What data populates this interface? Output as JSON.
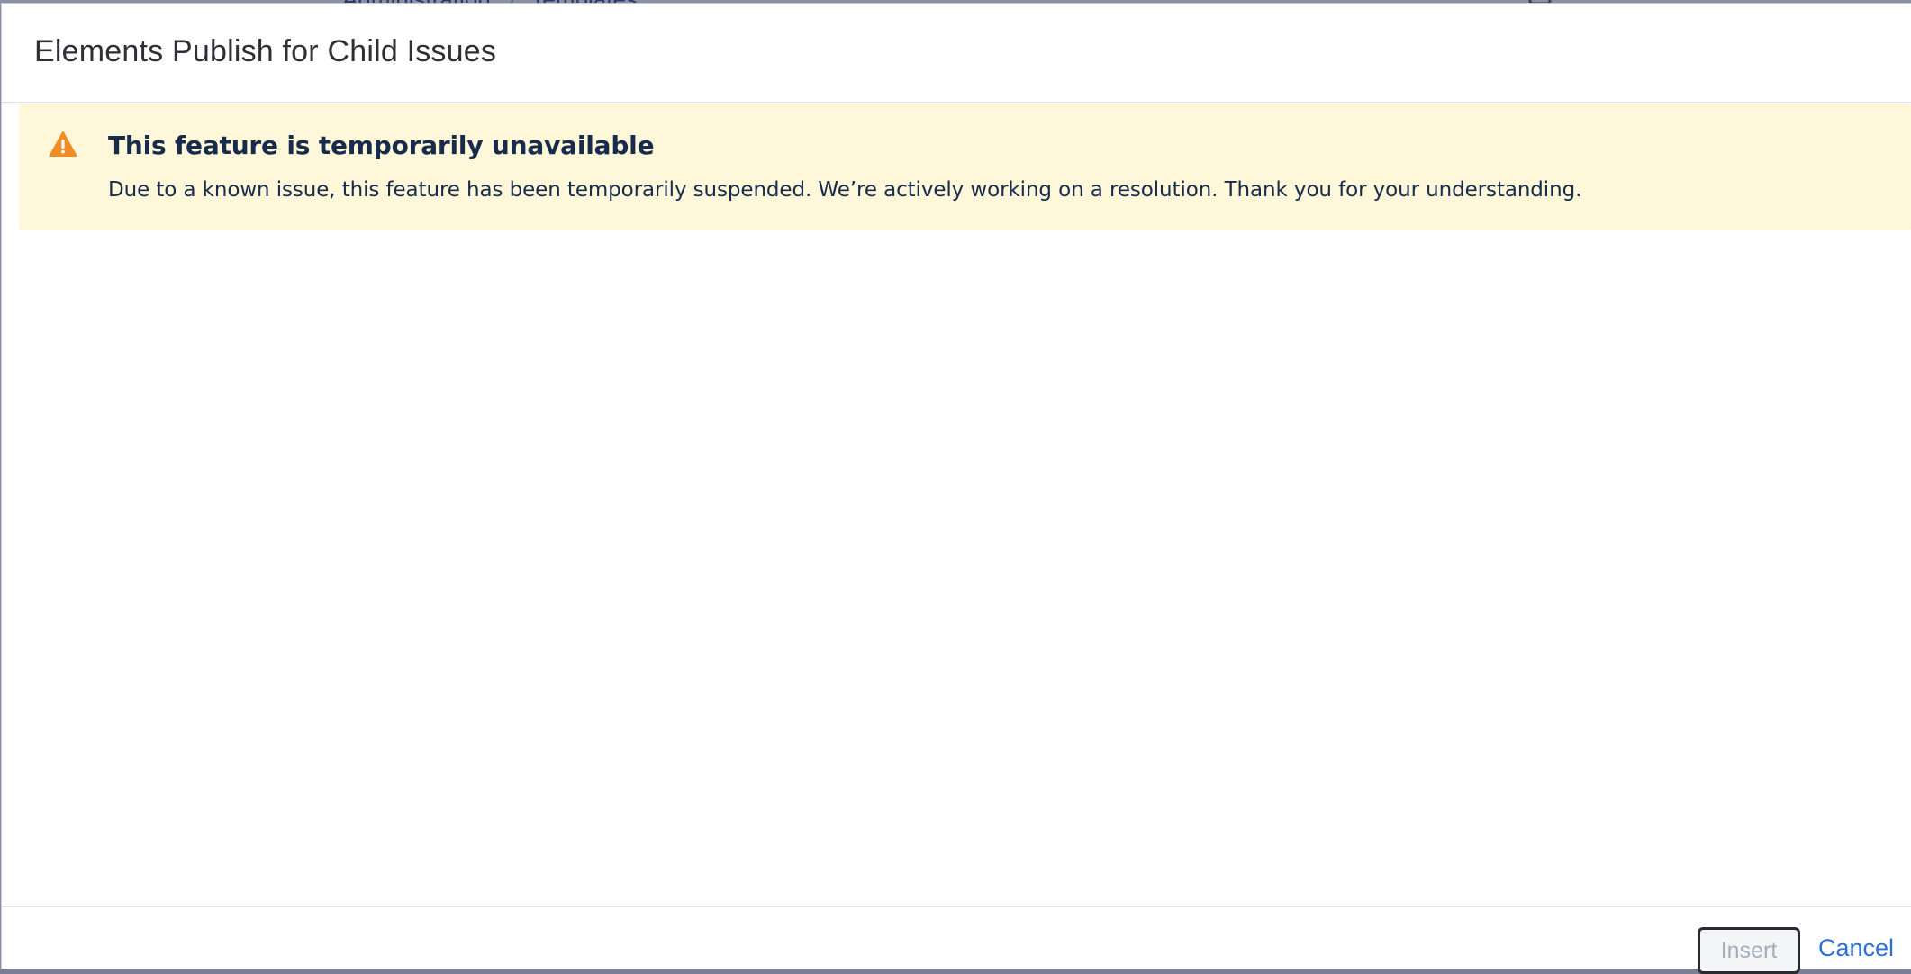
{
  "background": {
    "breadcrumb": [
      "Administration",
      "Templates"
    ]
  },
  "dialog": {
    "title": "Elements Publish for Child Issues",
    "banner": {
      "icon": "warning-icon",
      "title": "This feature is temporarily unavailable",
      "message": "Due to a known issue, this feature has been temporarily suspended. We’re actively working on a resolution. Thank you for your understanding."
    },
    "footer": {
      "insert_label": "Insert",
      "cancel_label": "Cancel"
    }
  },
  "colors": {
    "banner_background": "#fff7d9",
    "warning_icon": "#f18d27",
    "link": "#2d6fd6",
    "text": "#172b4d"
  }
}
